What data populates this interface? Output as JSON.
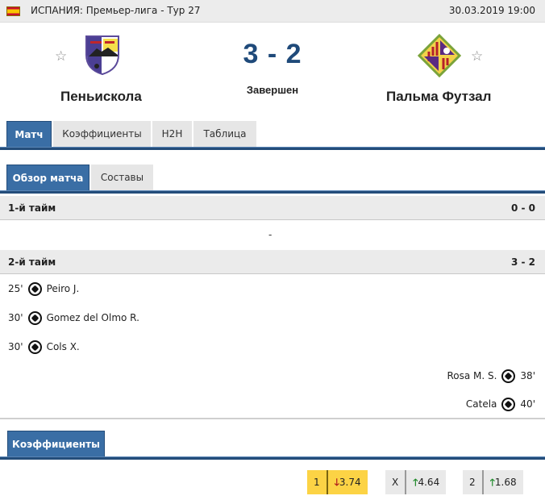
{
  "header": {
    "country_flag_icon": "spain-flag-icon",
    "league": "ИСПАНИЯ: Премьер-лига - Тур 27",
    "datetime": "30.03.2019 19:00"
  },
  "match": {
    "home": {
      "name": "Пеньискола",
      "logo": "peniscola-crest-icon",
      "favorite_icon": "star-outline-icon"
    },
    "away": {
      "name": "Пальма Футзал",
      "logo": "palma-futsal-crest-icon",
      "favorite_icon": "star-outline-icon"
    },
    "score": "3 - 2",
    "status": "Завершен"
  },
  "main_tabs": [
    {
      "label": "Матч",
      "active": true
    },
    {
      "label": "Коэффициенты",
      "active": false
    },
    {
      "label": "H2H",
      "active": false
    },
    {
      "label": "Таблица",
      "active": false
    }
  ],
  "sub_tabs": [
    {
      "label": "Обзор матча",
      "active": true
    },
    {
      "label": "Составы",
      "active": false
    }
  ],
  "periods": [
    {
      "title": "1-й тайм",
      "score": "0 - 0",
      "empty_text": "-",
      "events": []
    },
    {
      "title": "2-й тайм",
      "score": "3 - 2",
      "events": [
        {
          "side": "home",
          "minute": "25'",
          "icon": "soccer-ball-icon",
          "player": "Peiro J."
        },
        {
          "side": "home",
          "minute": "30'",
          "icon": "soccer-ball-icon",
          "player": "Gomez del Olmo R."
        },
        {
          "side": "home",
          "minute": "30'",
          "icon": "soccer-ball-icon",
          "player": "Cols X."
        },
        {
          "side": "away",
          "minute": "38'",
          "icon": "soccer-ball-icon",
          "player": "Rosa M. S."
        },
        {
          "side": "away",
          "minute": "40'",
          "icon": "soccer-ball-icon",
          "player": "Catela"
        }
      ]
    }
  ],
  "odds_section": {
    "tab_label": "Коэффициенты",
    "odds": [
      {
        "label": "1",
        "value": "3.74",
        "trend": "down",
        "trend_icon": "arrow-down-icon",
        "highlighted": true
      },
      {
        "label": "X",
        "value": "4.64",
        "trend": "up",
        "trend_icon": "arrow-up-icon",
        "highlighted": false
      },
      {
        "label": "2",
        "value": "1.68",
        "trend": "up",
        "trend_icon": "arrow-up-icon",
        "highlighted": false
      }
    ]
  },
  "colors": {
    "accent": "#3a6ea5",
    "accent_dark": "#244d7a",
    "score": "#1f4a7a",
    "highlight_odds": "#fcd345",
    "trend_up": "#1f8a2a",
    "trend_down": "#b01c1c"
  }
}
